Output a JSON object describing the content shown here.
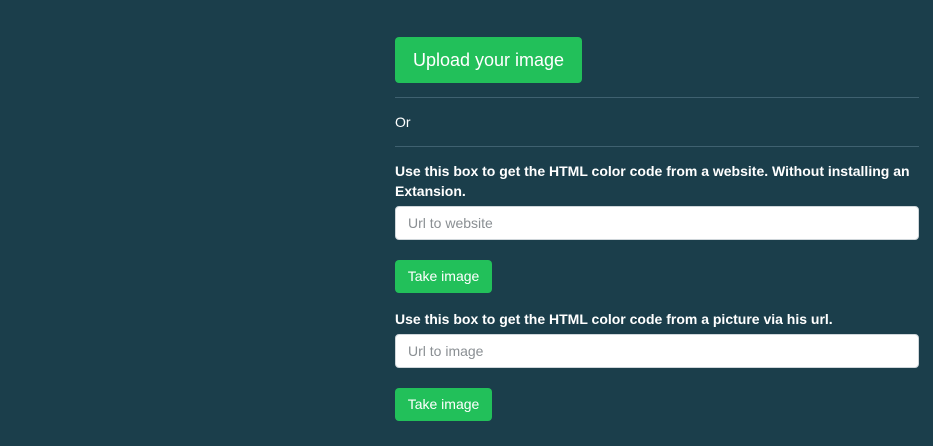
{
  "upload": {
    "button_label": "Upload your image"
  },
  "separator": {
    "or_text": "Or"
  },
  "website_section": {
    "label": "Use this box to get the HTML color code from a website. Without installing an Extansion.",
    "input_placeholder": "Url to website",
    "input_value": "",
    "button_label": "Take image"
  },
  "picture_section": {
    "label": "Use this box to get the HTML color code from a picture via his url.",
    "input_placeholder": "Url to image",
    "input_value": "",
    "button_label": "Take image"
  },
  "colors": {
    "background": "#1b3e4b",
    "accent_green": "#22c05a",
    "text": "#ffffff"
  }
}
